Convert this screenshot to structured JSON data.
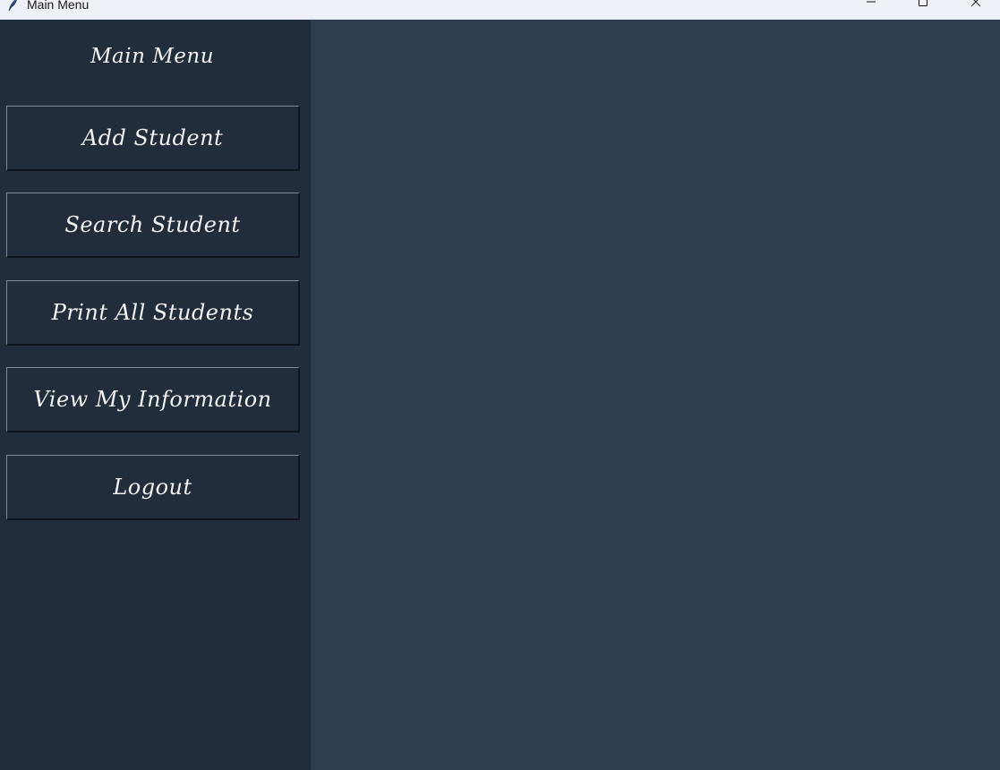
{
  "window": {
    "title": "Main Menu",
    "icon": "feather-icon",
    "controls": [
      "minimize-icon",
      "maximize-icon",
      "close-icon"
    ]
  },
  "sidebar": {
    "title": "Main Menu",
    "buttons": [
      {
        "label": "Add Student"
      },
      {
        "label": "Search Student"
      },
      {
        "label": "Print All Students"
      },
      {
        "label": "View My Information"
      },
      {
        "label": "Logout"
      }
    ]
  },
  "colors": {
    "sidebar_bg": "#212d3a",
    "main_bg": "#2c3e50",
    "text": "#f2f2f2",
    "titlebar_bg": "#eef2f8"
  }
}
